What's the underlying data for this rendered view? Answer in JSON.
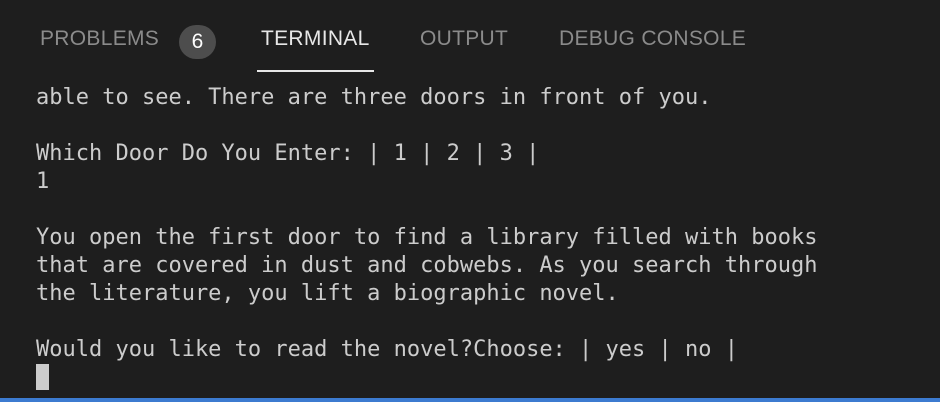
{
  "panel": {
    "tabs": {
      "problems": "PROBLEMS",
      "terminal": "TERMINAL",
      "output": "OUTPUT",
      "debug_console": "DEBUG CONSOLE"
    },
    "problems_count": "6",
    "active_tab": "TERMINAL"
  },
  "terminal": {
    "lines": [
      "able to see. There are three doors in front of you.",
      "",
      "Which Door Do You Enter: | 1 | 2 | 3 |",
      "1",
      "",
      "You open the first door to find a library filled with books",
      "that are covered in dust and cobwebs. As you search through",
      "the literature, you lift a biographic novel.",
      "",
      "Would you like to read the novel?Choose: | yes | no |"
    ]
  },
  "colors": {
    "background": "#1e1e1e",
    "text": "#cccccc",
    "active_tab": "#e7e7e7",
    "inactive_tab": "#8b8b8b",
    "badge": "#4d4d4d",
    "status_strip": "#3c7bd0"
  }
}
